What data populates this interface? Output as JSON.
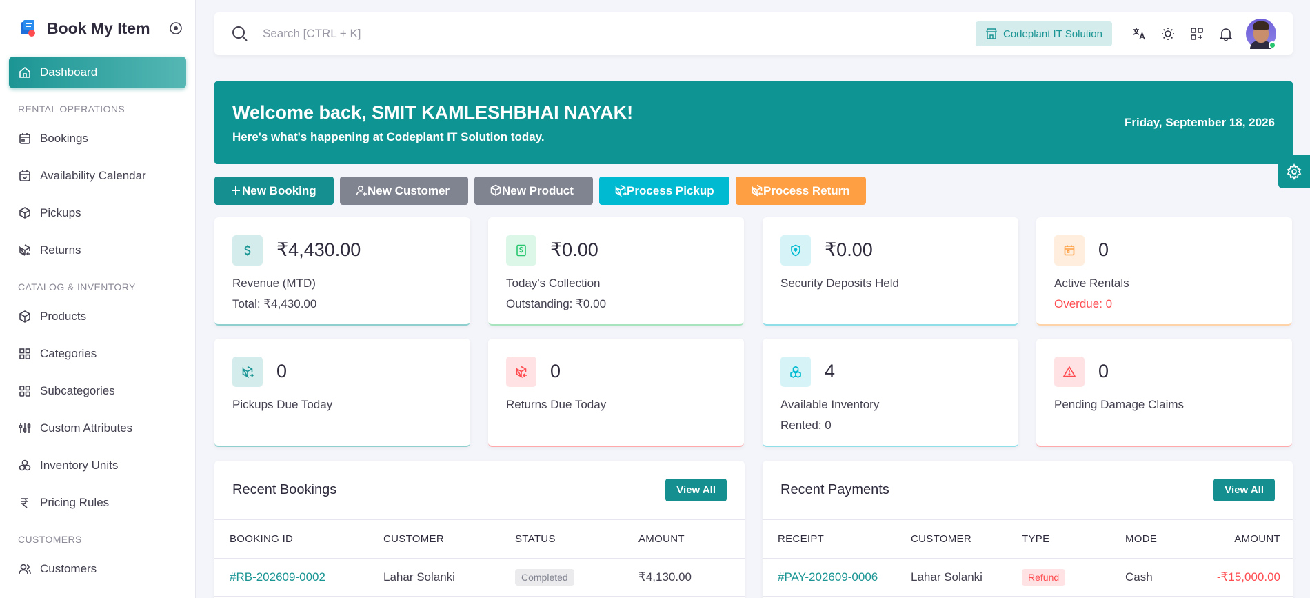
{
  "app": {
    "title": "Book My Item"
  },
  "sidebar": {
    "dashboard": "Dashboard",
    "sections": {
      "rental": "RENTAL OPERATIONS",
      "catalog": "CATALOG & INVENTORY",
      "customers": "CUSTOMERS"
    },
    "rental_items": [
      "Bookings",
      "Availability Calendar",
      "Pickups",
      "Returns"
    ],
    "catalog_items": [
      "Products",
      "Categories",
      "Subcategories",
      "Custom Attributes",
      "Inventory Units",
      "Pricing Rules"
    ],
    "customer_items": [
      "Customers"
    ]
  },
  "topbar": {
    "search_placeholder": "Search [CTRL + K]",
    "company": "Codeplant IT Solution",
    "icons": [
      "translate-icon",
      "sun-icon",
      "apps-grid-icon",
      "bell-icon"
    ]
  },
  "welcome": {
    "title": "Welcome back, SMIT KAMLESHBHAI NAYAK!",
    "subtitle": "Here's what's happening at Codeplant IT Solution today.",
    "date": "Friday, September 18, 2026"
  },
  "actions": {
    "new_booking": "New Booking",
    "new_customer": "New Customer",
    "new_product": "New Product",
    "process_pickup": "Process Pickup",
    "process_return": "Process Return"
  },
  "stats": {
    "revenue": {
      "value": "₹4,430.00",
      "label": "Revenue (MTD)",
      "sub": "Total: ₹4,430.00"
    },
    "collection": {
      "value": "₹0.00",
      "label": "Today's Collection",
      "sub": "Outstanding: ₹0.00"
    },
    "deposits": {
      "value": "₹0.00",
      "label": "Security Deposits Held"
    },
    "active_rentals": {
      "value": "0",
      "label": "Active Rentals",
      "sub": "Overdue: 0"
    },
    "pickups_due": {
      "value": "0",
      "label": "Pickups Due Today"
    },
    "returns_due": {
      "value": "0",
      "label": "Returns Due Today"
    },
    "available_inventory": {
      "value": "4",
      "label": "Available Inventory",
      "sub": "Rented: 0"
    },
    "damage_claims": {
      "value": "0",
      "label": "Pending Damage Claims"
    }
  },
  "colors": {
    "brand": "#0f9494",
    "danger": "#ff4c51",
    "info": "#00bad1",
    "warning": "#ff9f43",
    "secondary": "#808390"
  },
  "recent_bookings": {
    "title": "Recent Bookings",
    "view_all": "View All",
    "columns": [
      "BOOKING ID",
      "CUSTOMER",
      "STATUS",
      "AMOUNT"
    ],
    "rows": [
      {
        "id": "#RB-202609-0002",
        "customer": "Lahar Solanki",
        "status": "Completed",
        "amount": "₹4,130.00"
      }
    ]
  },
  "recent_payments": {
    "title": "Recent Payments",
    "view_all": "View All",
    "columns": [
      "RECEIPT",
      "CUSTOMER",
      "TYPE",
      "MODE",
      "AMOUNT"
    ],
    "rows": [
      {
        "receipt": "#PAY-202609-0006",
        "customer": "Lahar Solanki",
        "type": "Refund",
        "mode": "Cash",
        "amount": "-₹15,000.00"
      }
    ]
  }
}
